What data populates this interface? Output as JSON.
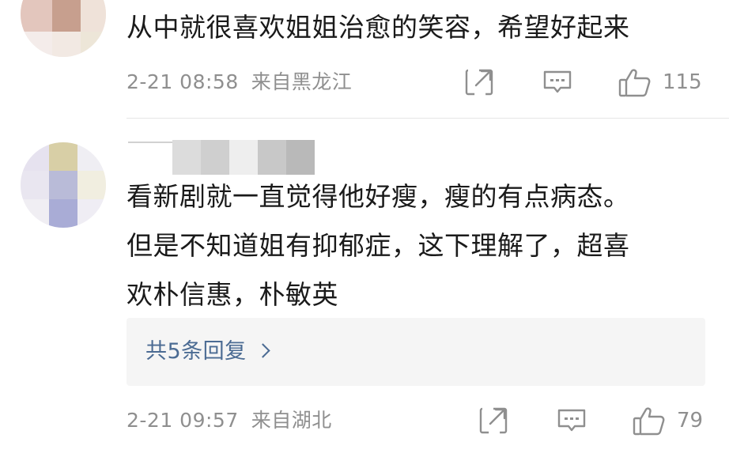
{
  "comments": [
    {
      "text": "从中就很喜欢姐姐治愈的笑容，希望好起来",
      "date": "2-21 08:58",
      "location": "来自黑龙江",
      "likes": "115"
    },
    {
      "text_lines": [
        "看新剧就一直觉得他好瘦，瘦的有点病态。",
        "但是不知道姐有抑郁症，这下理解了，超喜",
        "欢朴信惠，朴敏英"
      ],
      "replies_label": "共5条回复",
      "date": "2-21 09:57",
      "location": "来自湖北",
      "likes": "79"
    }
  ],
  "icons": {
    "share": "share-icon",
    "reply": "comment-icon",
    "like": "thumbs-up-icon"
  },
  "colors": {
    "text": "#1a1a1a",
    "meta": "#8f8f8f",
    "link": "#4b6b93",
    "reply_box": "#f5f5f5",
    "divider": "#e6e6e6"
  }
}
